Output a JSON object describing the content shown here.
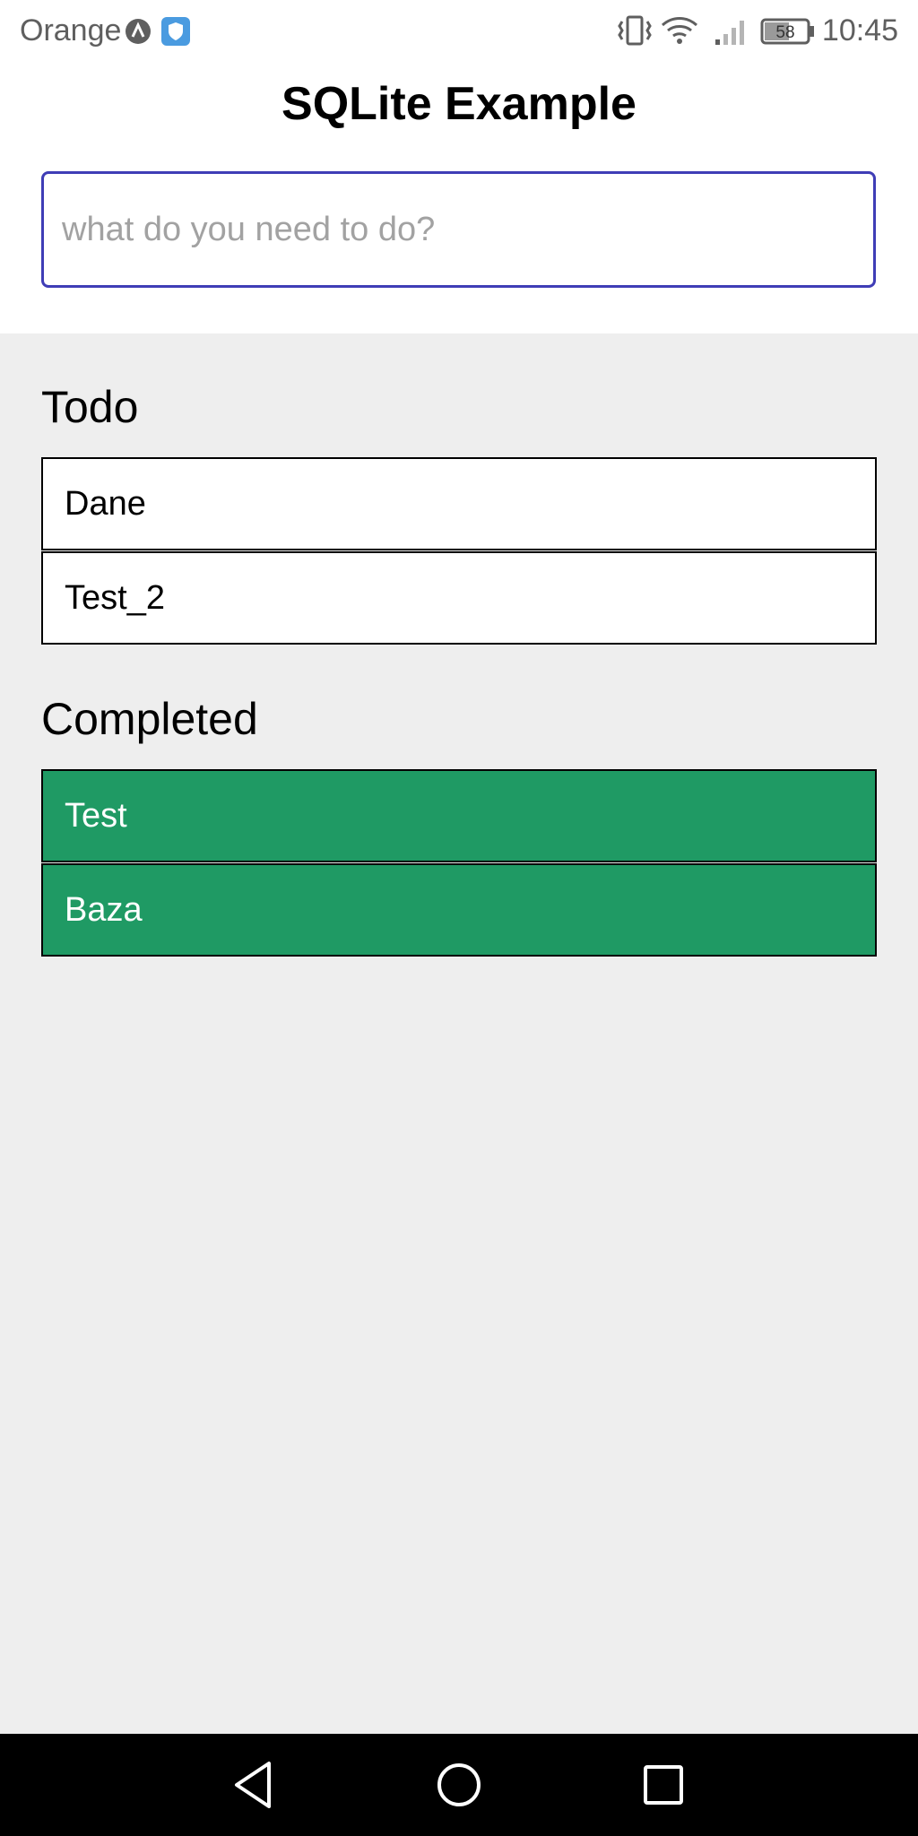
{
  "status_bar": {
    "carrier": "Orange",
    "battery": "58",
    "time": "10:45",
    "icons": [
      "app-a-icon",
      "shield-icon",
      "vibrate-icon",
      "wifi-icon",
      "signal-icon",
      "battery-icon"
    ]
  },
  "header": {
    "title": "SQLite Example",
    "input_placeholder": "what do you need to do?",
    "input_value": ""
  },
  "todo": {
    "heading": "Todo",
    "items": [
      {
        "label": "Dane"
      },
      {
        "label": "Test_2"
      }
    ]
  },
  "completed": {
    "heading": "Completed",
    "items": [
      {
        "label": "Test"
      },
      {
        "label": "Baza"
      }
    ]
  },
  "nav_bar": {
    "icons": [
      "back-icon",
      "home-icon",
      "recents-icon"
    ]
  },
  "colors": {
    "accent_border": "#3f3db6",
    "completed_bg": "#1f9a64",
    "body_bg": "#eeeeee",
    "header_bg": "#ffffff"
  }
}
